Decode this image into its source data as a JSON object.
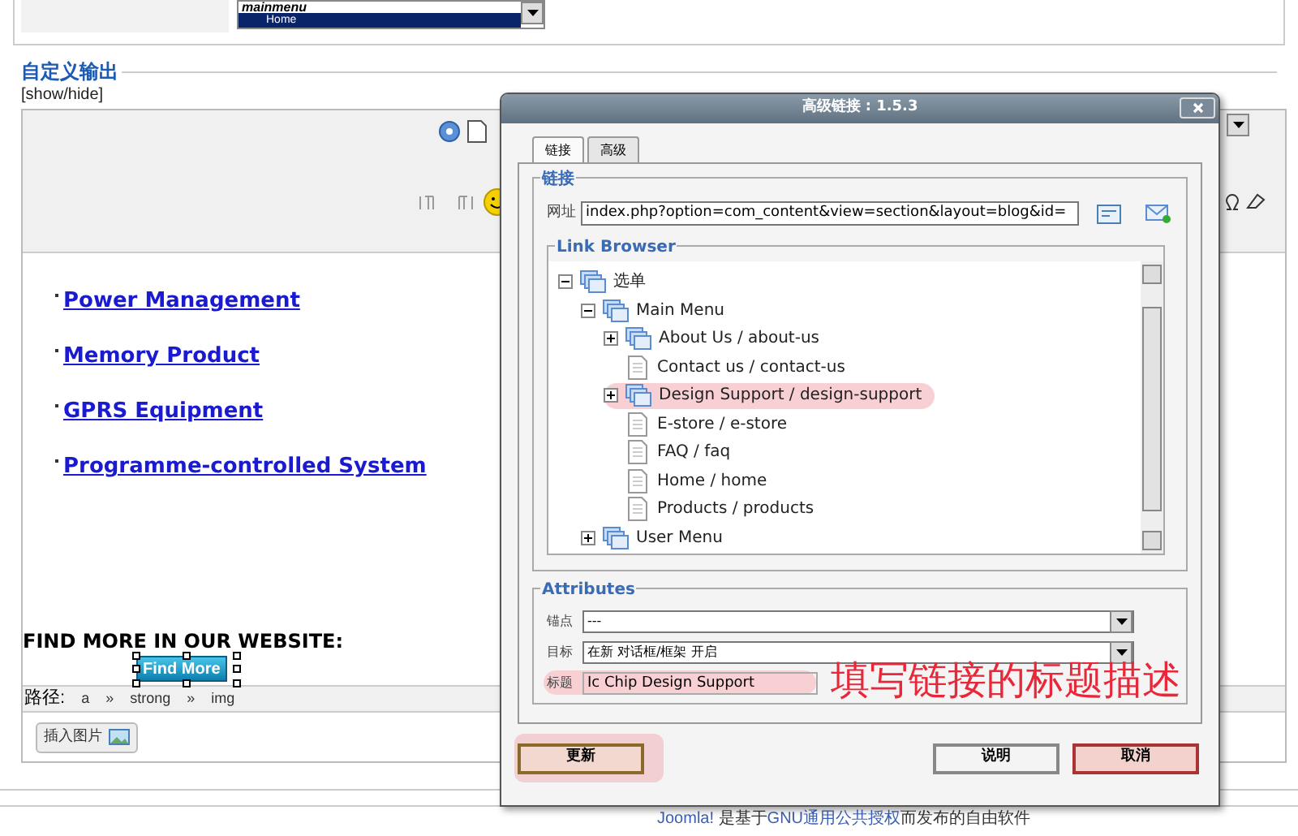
{
  "menu_select": {
    "header": "mainmenu",
    "selected_item": "Home"
  },
  "section": {
    "title": "自定义输出",
    "toggle": "[show/hide]"
  },
  "editor": {
    "links": [
      "Power Management",
      "Memory Product",
      "GPRS Equipment",
      "Programme-controlled System"
    ],
    "heading": "FIND MORE IN OUR WEBSITE:",
    "image_button": "Find More",
    "image_selected": true,
    "path_label": "路径:",
    "path": [
      "a",
      "»",
      "strong",
      "»",
      "img"
    ],
    "insert_image_button": "插入图片"
  },
  "footer": [
    {
      "kind": "link",
      "text": "Joomla!"
    },
    {
      "kind": "text",
      "text": " 是基于"
    },
    {
      "kind": "link",
      "text": "GNU通用公共授权"
    },
    {
      "kind": "text",
      "text": "而发布的自由软件"
    }
  ],
  "dialog": {
    "title": "高级链接 : 1.5.3",
    "tabs": [
      {
        "label": "链接",
        "selected": true
      },
      {
        "label": "高级",
        "selected": false
      }
    ],
    "link_group": "链接",
    "url_label": "网址",
    "url_value": "index.php?option=com_content&view=section&layout=blog&id=",
    "browser_title": "Link Browser",
    "tree": [
      {
        "label": "选单",
        "kind": "menu",
        "expanded": true,
        "highlighted": false,
        "children": [
          {
            "label": "Main Menu",
            "kind": "menu",
            "expanded": true,
            "highlighted": false,
            "children": [
              {
                "label": "About Us / about-us",
                "kind": "menu",
                "expanded": false,
                "highlighted": false
              },
              {
                "label": "Contact us / contact-us",
                "kind": "page",
                "highlighted": false
              },
              {
                "label": "Design Support / design-support",
                "kind": "menu",
                "expanded": false,
                "highlighted": true
              },
              {
                "label": "E-store / e-store",
                "kind": "page",
                "highlighted": false
              },
              {
                "label": "FAQ / faq",
                "kind": "page",
                "highlighted": false
              },
              {
                "label": "Home / home",
                "kind": "page",
                "highlighted": false
              },
              {
                "label": "Products / products",
                "kind": "page",
                "highlighted": false
              }
            ]
          },
          {
            "label": "User Menu",
            "kind": "menu",
            "expanded": false,
            "highlighted": false
          }
        ]
      }
    ],
    "attributes_title": "Attributes",
    "attributes": [
      {
        "label": "锚点",
        "kind": "select",
        "value": "---",
        "highlighted": false
      },
      {
        "label": "目标",
        "kind": "select",
        "value": "在新 对话框/框架 开启",
        "highlighted": false
      },
      {
        "label": "标题",
        "kind": "text",
        "value": "Ic Chip Design Support",
        "highlighted": true
      }
    ],
    "buttons": [
      {
        "label": "更新",
        "kind": "primary",
        "highlighted": true
      },
      {
        "label": "说明",
        "kind": "plain",
        "highlighted": false
      },
      {
        "label": "取消",
        "kind": "cancel",
        "highlighted": false
      }
    ]
  },
  "annotation": "填写链接的标题描述"
}
